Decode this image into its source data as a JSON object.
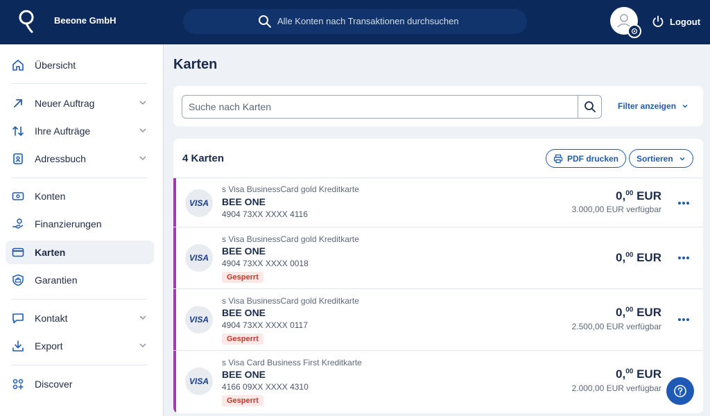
{
  "header": {
    "company": "Beeone GmbH",
    "search_placeholder": "Alle Konten nach Transaktionen durchsuchen",
    "logout": "Logout"
  },
  "sidebar": {
    "items": [
      {
        "label": "Übersicht",
        "icon": "home-icon"
      },
      {
        "label": "Neuer Auftrag",
        "icon": "arrow-up-right-icon"
      },
      {
        "label": "Ihre Aufträge",
        "icon": "sort-arrows-icon"
      },
      {
        "label": "Adressbuch",
        "icon": "address-book-icon"
      },
      {
        "label": "Konten",
        "icon": "account-icon"
      },
      {
        "label": "Finanzierungen",
        "icon": "financing-icon"
      },
      {
        "label": "Karten",
        "icon": "card-icon"
      },
      {
        "label": "Garantien",
        "icon": "guarantee-icon"
      },
      {
        "label": "Kontakt",
        "icon": "chat-icon"
      },
      {
        "label": "Export",
        "icon": "download-icon"
      },
      {
        "label": "Discover",
        "icon": "discover-icon"
      }
    ]
  },
  "main": {
    "title": "Karten",
    "search_placeholder": "Suche nach Karten",
    "filter_label": "Filter anzeigen",
    "count_label": "4 Karten",
    "pdf_label": "PDF drucken",
    "sort_label": "Sortieren"
  },
  "cards": [
    {
      "logo": "VISA",
      "type": "s Visa BusinessCard gold Kreditkarte",
      "name": "BEE ONE",
      "number": "4904 73XX XXXX 4116",
      "status": "",
      "amount_main": "0,",
      "amount_sup": "00",
      "currency": "EUR",
      "available": "3.000,00 EUR verfügbar"
    },
    {
      "logo": "VISA",
      "type": "s Visa BusinessCard gold Kreditkarte",
      "name": "BEE ONE",
      "number": "4904 73XX XXXX 0018",
      "status": "Gesperrt",
      "amount_main": "0,",
      "amount_sup": "00",
      "currency": "EUR",
      "available": ""
    },
    {
      "logo": "VISA",
      "type": "s Visa BusinessCard gold Kreditkarte",
      "name": "BEE ONE",
      "number": "4904 73XX XXXX 0117",
      "status": "Gesperrt",
      "amount_main": "0,",
      "amount_sup": "00",
      "currency": "EUR",
      "available": "2.500,00 EUR verfügbar"
    },
    {
      "logo": "VISA",
      "type": "s Visa Card Business First Kreditkarte",
      "name": "BEE ONE",
      "number": "4166 09XX XXXX 4310",
      "status": "Gesperrt",
      "amount_main": "0,",
      "amount_sup": "00",
      "currency": "EUR",
      "available": "2.000,00 EUR verfügbar"
    }
  ],
  "colors": {
    "header": "#0b2a5b",
    "accent": "#1e5ab5",
    "row_marker": "#a23bb0",
    "blocked_bg": "#fde8e8",
    "blocked_text": "#c0392b"
  }
}
